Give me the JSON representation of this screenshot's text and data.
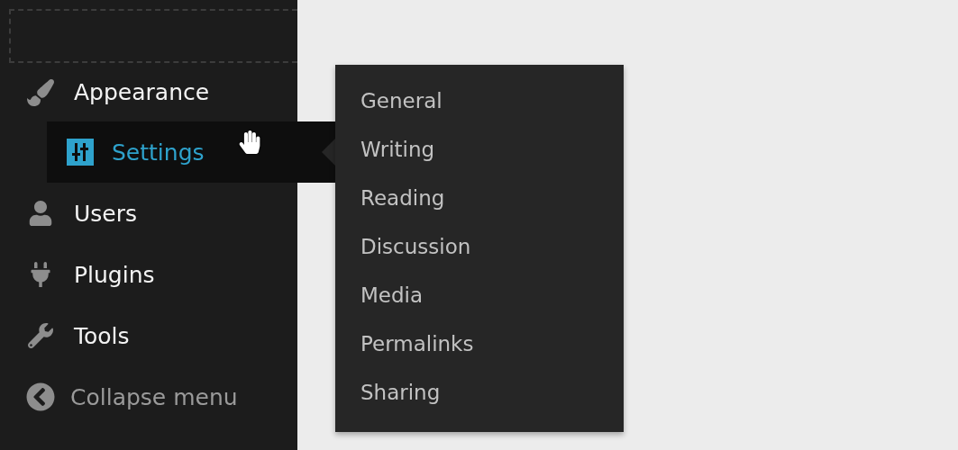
{
  "menu": [
    {
      "label": "Appearance",
      "selected": false
    },
    {
      "label": "Settings",
      "selected": true
    },
    {
      "label": "Users",
      "selected": false
    },
    {
      "label": "Plugins",
      "selected": false
    },
    {
      "label": "Tools",
      "selected": false
    }
  ],
  "collapse": {
    "label": "Collapse menu"
  },
  "submenu": [
    {
      "label": "General"
    },
    {
      "label": "Writing"
    },
    {
      "label": "Reading"
    },
    {
      "label": "Discussion"
    },
    {
      "label": "Media"
    },
    {
      "label": "Permalinks"
    },
    {
      "label": "Sharing"
    }
  ]
}
